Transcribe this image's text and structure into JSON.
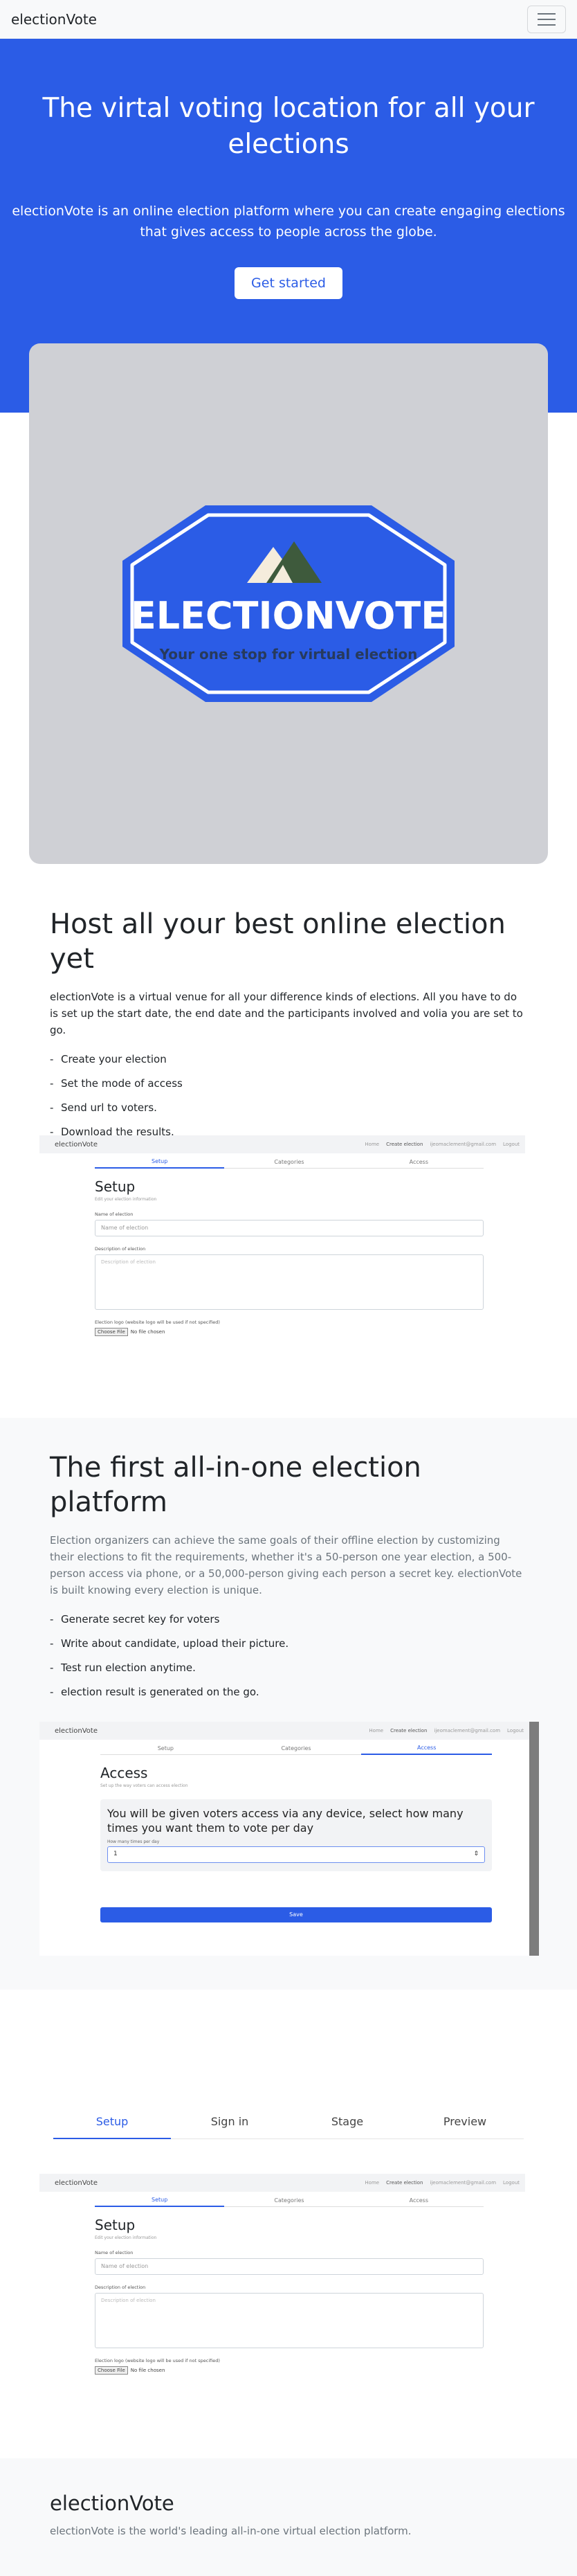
{
  "navbar": {
    "brand": "electionVote"
  },
  "hero": {
    "title": "The virtal voting location for all your elections",
    "subtitle": "electionVote is an online election platform where you can create engaging elections that gives access to people across the globe.",
    "cta": "Get started",
    "logo": {
      "wordmark": "ELECTIONVOTE",
      "tagline": "Your one stop for virtual election"
    }
  },
  "section1": {
    "title": "Host all your best online election yet",
    "text": "electionVote is a virtual venue for all your difference kinds of elections. All you have to do is set up the start date, the end date and the participants involved and volia you are set to go.",
    "items": [
      "Create your election",
      "Set the mode of access",
      "Send url to voters.",
      "Download the results."
    ]
  },
  "setup_screen": {
    "brand": "electionVote",
    "nav": [
      "Home",
      "Create election",
      "ijeomaclement@gmail.com",
      "Logout"
    ],
    "tabs": [
      "Setup",
      "Categories",
      "Access"
    ],
    "heading": "Setup",
    "subheading": "Edit your election information",
    "name_label": "Name of election",
    "name_placeholder": "Name of election",
    "desc_label": "Description of election",
    "desc_placeholder": "Description of election",
    "logo_label": "Election logo (website logo will be used if not specified)",
    "file_button": "Choose File",
    "file_status": "No file chosen"
  },
  "section2": {
    "title": "The first all-in-one election platform",
    "text": "Election organizers can achieve the same goals of their offline election by customizing their elections to fit the requirements, whether it's a 50-person one year election, a 500-person access via phone, or a 50,000-person giving each person a secret key. electionVote is built knowing every election is unique.",
    "items": [
      "Generate secret key for voters",
      "Write about candidate, upload their picture.",
      "Test run election anytime.",
      "election result is generated on the go."
    ]
  },
  "access_screen": {
    "brand": "electionVote",
    "nav": [
      "Home",
      "Create election",
      "ijeomaclement@gmail.com",
      "Logout"
    ],
    "tabs": [
      "Setup",
      "Categories",
      "Access"
    ],
    "heading": "Access",
    "subheading": "Set up the way voters can access election",
    "alert_title": "You will be given voters access via any device, select how many times you want them to vote per day",
    "times_label": "How many times per day",
    "times_value": "1",
    "save": "Save"
  },
  "mid_tabs": [
    "Setup",
    "Sign in",
    "Stage",
    "Preview"
  ],
  "footer": {
    "brand": "electionVote",
    "text": "electionVote is the world's leading all-in-one virtual election platform."
  },
  "colors": {
    "primary": "#2b5ce6",
    "light": "#f8f9fa",
    "card": "#cfd0d5"
  }
}
